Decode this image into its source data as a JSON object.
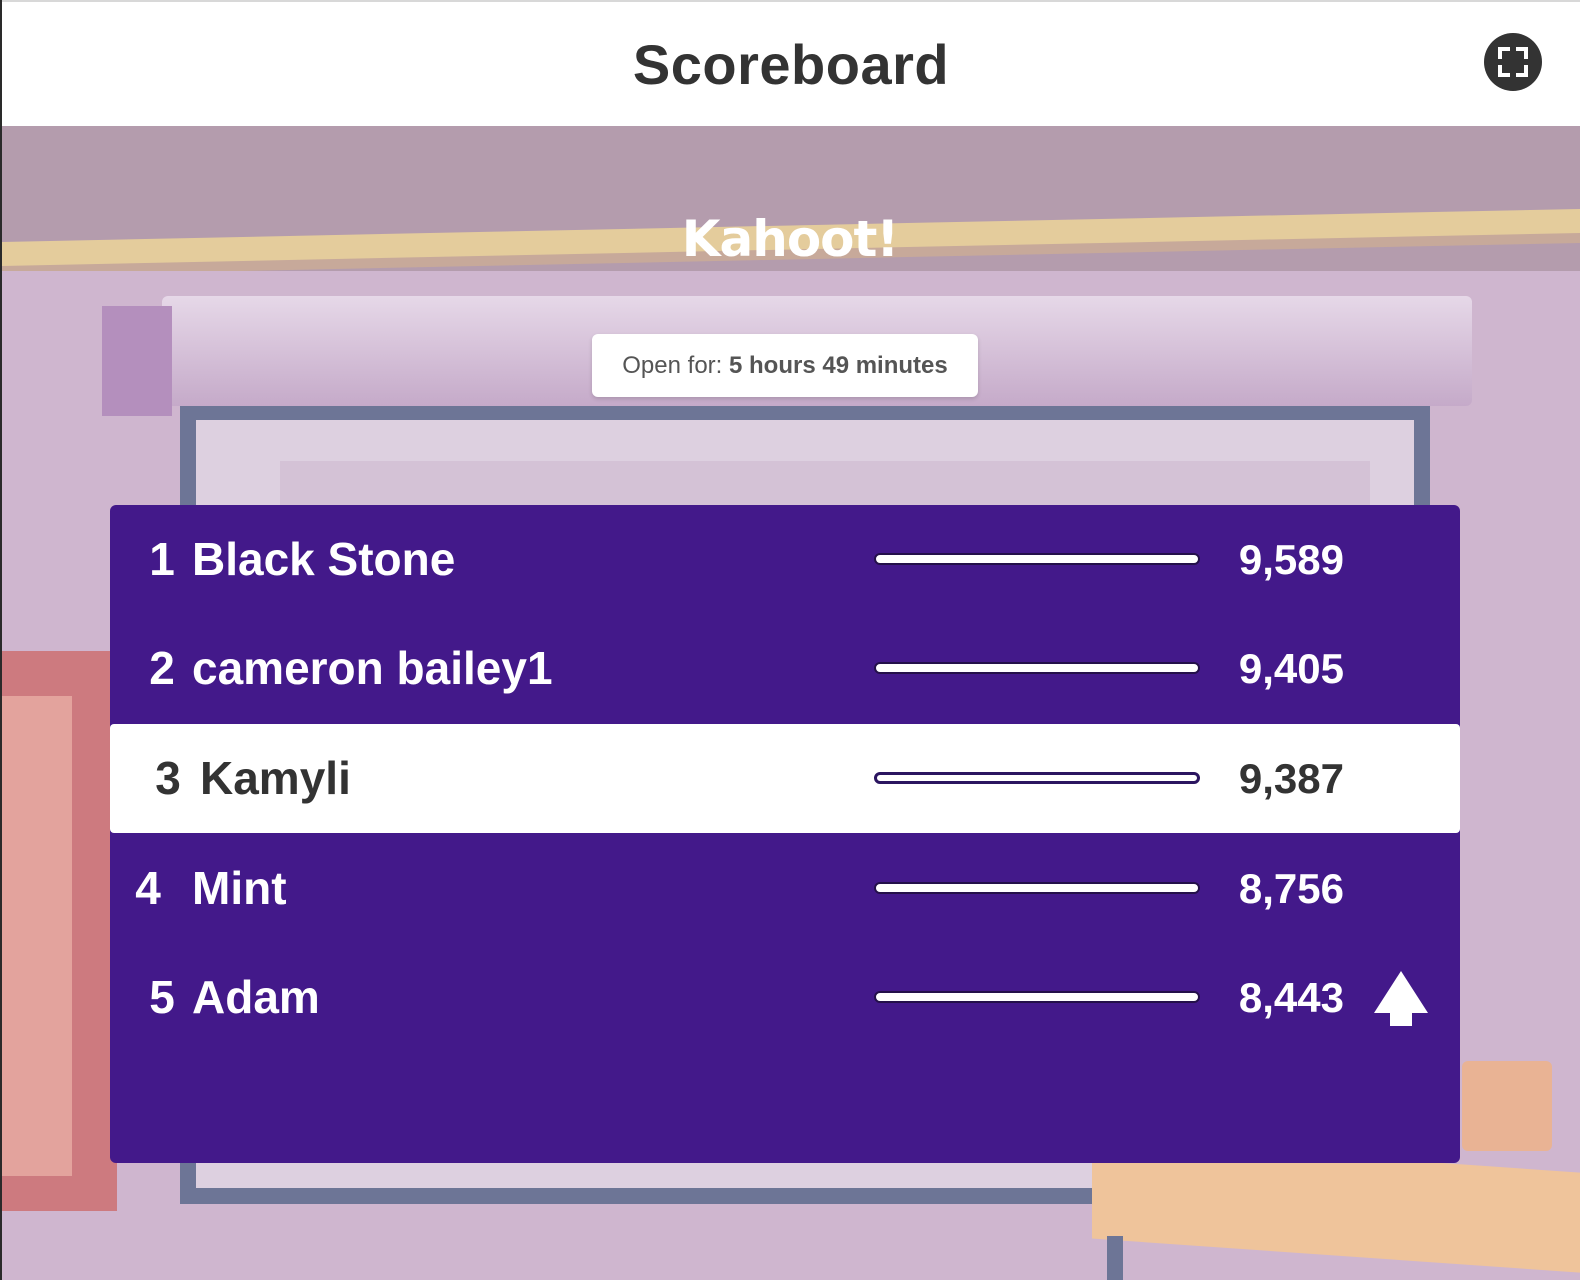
{
  "header": {
    "title": "Scoreboard",
    "fullscreen_icon": "fullscreen-icon"
  },
  "logo_text": "Kahoot!",
  "open_for": {
    "label": "Open for:",
    "value": "5 hours 49 minutes"
  },
  "scoreboard": {
    "rows": [
      {
        "rank": "1",
        "name": "Black Stone",
        "score": "9,589",
        "highlighted": false
      },
      {
        "rank": "2",
        "name": "cameron bailey1",
        "score": "9,405",
        "highlighted": false
      },
      {
        "rank": "3",
        "name": "Kamyli",
        "score": "9,387",
        "highlighted": true
      },
      {
        "rank": "4",
        "name": "Mint",
        "score": "8,756",
        "highlighted": false
      },
      {
        "rank": "5",
        "name": "Adam",
        "score": "8,443",
        "highlighted": false,
        "trend_icon": "arrow-up-icon"
      }
    ]
  },
  "colors": {
    "panel": "#43198a",
    "highlight_row": "#ffffff",
    "header_text": "#333333"
  }
}
